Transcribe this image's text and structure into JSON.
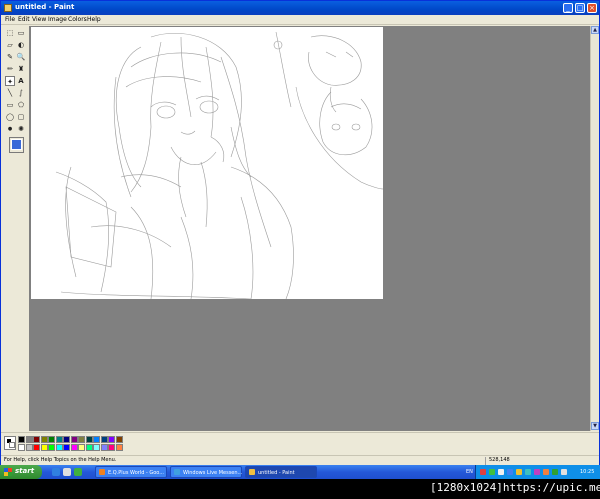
{
  "window": {
    "title": "untitled - Paint",
    "minimize_symbol": "_",
    "maximize_symbol": "□",
    "close_symbol": "×"
  },
  "menu": [
    "File",
    "Edit",
    "View",
    "Image",
    "Colors",
    "Help"
  ],
  "tools": [
    {
      "name": "free-form-select",
      "glyph": "⬚"
    },
    {
      "name": "select",
      "glyph": "▭"
    },
    {
      "name": "eraser",
      "glyph": "▱"
    },
    {
      "name": "fill-with-color",
      "glyph": "◐"
    },
    {
      "name": "pick-color",
      "glyph": "✎"
    },
    {
      "name": "magnifier",
      "glyph": "🔍"
    },
    {
      "name": "pencil",
      "glyph": "✏"
    },
    {
      "name": "brush",
      "glyph": "♜"
    },
    {
      "name": "airbrush",
      "glyph": "✦"
    },
    {
      "name": "text",
      "glyph": "A"
    },
    {
      "name": "line",
      "glyph": "╲"
    },
    {
      "name": "curve",
      "glyph": "∫"
    },
    {
      "name": "rectangle",
      "glyph": "▭"
    },
    {
      "name": "polygon",
      "glyph": "⬠"
    },
    {
      "name": "ellipse",
      "glyph": "◯"
    },
    {
      "name": "rounded-rectangle",
      "glyph": "▢"
    },
    {
      "name": "brush-shape-dot",
      "glyph": "●"
    },
    {
      "name": "brush-shape-star",
      "glyph": "✺"
    }
  ],
  "palette": [
    "#000000",
    "#808080",
    "#800000",
    "#808000",
    "#008000",
    "#008080",
    "#000080",
    "#800080",
    "#808040",
    "#004040",
    "#0080ff",
    "#004080",
    "#8000ff",
    "#804000",
    "#ffffff",
    "#c0c0c0",
    "#ff0000",
    "#ffff00",
    "#00ff00",
    "#00ffff",
    "#0000ff",
    "#ff00ff",
    "#ffff80",
    "#00ff80",
    "#80ffff",
    "#8080ff",
    "#ff0080",
    "#ff8040"
  ],
  "status": {
    "help": "For Help, click Help Topics on the Help Menu.",
    "coords": "528,148"
  },
  "taskbar": {
    "start": "start",
    "tasks": [
      {
        "label": "E.Q.Plus World - Goo...",
        "color": "#f08020"
      },
      {
        "label": "Windows Live Messen...",
        "color": "#40a0e0"
      },
      {
        "label": "untitled - Paint",
        "color": "#f0c040"
      }
    ],
    "lang": "EN",
    "clock": "10:25"
  },
  "watermark": "[1280x1024]https://upic.me/"
}
